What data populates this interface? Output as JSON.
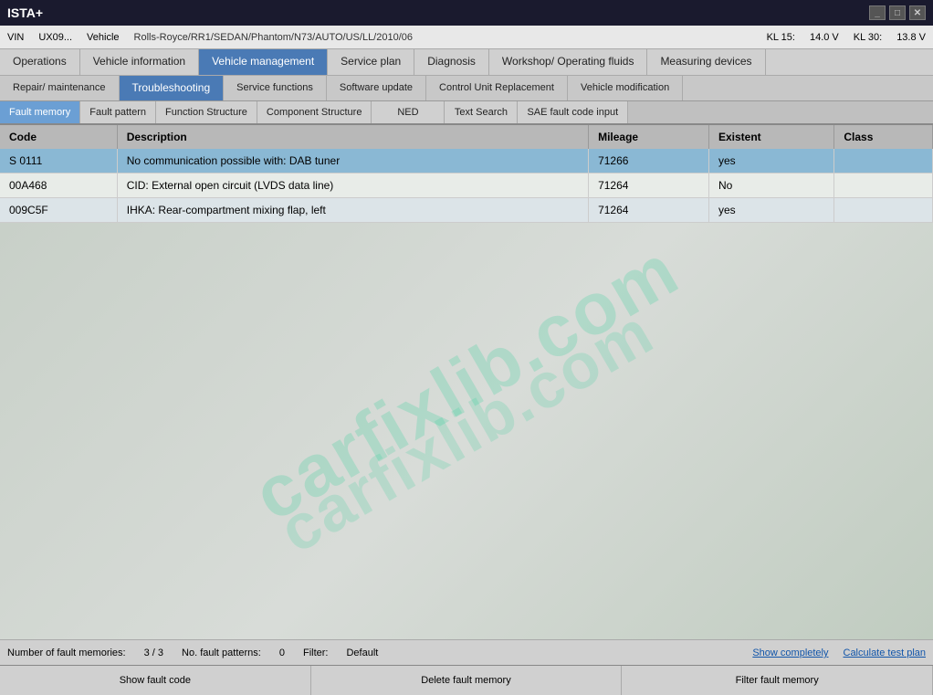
{
  "titlebar": {
    "app_name": "ISTA+",
    "controls": [
      "minimize",
      "maximize",
      "close"
    ]
  },
  "infobar": {
    "vin_label": "VIN",
    "vin_value": "UX09...",
    "vehicle_label": "Vehicle",
    "vehicle_value": "Rolls-Royce/RR1/SEDAN/Phantom/N73/AUTO/US/LL/2010/06",
    "kl15_label": "KL 15:",
    "kl15_value": "14.0 V",
    "kl30_label": "KL 30:",
    "kl30_value": "13.8 V"
  },
  "nav_row1": {
    "tabs": [
      {
        "id": "operations",
        "label": "Operations",
        "active": false
      },
      {
        "id": "vehicle-info",
        "label": "Vehicle information",
        "active": false
      },
      {
        "id": "vehicle-mgmt",
        "label": "Vehicle management",
        "active": true
      },
      {
        "id": "service-plan",
        "label": "Service plan",
        "active": false
      },
      {
        "id": "diagnosis",
        "label": "Diagnosis",
        "active": false
      },
      {
        "id": "workshop",
        "label": "Workshop/ Operating fluids",
        "active": false
      },
      {
        "id": "measuring",
        "label": "Measuring devices",
        "active": false
      }
    ]
  },
  "nav_row2": {
    "tabs": [
      {
        "id": "repair",
        "label": "Repair/ maintenance",
        "active": false
      },
      {
        "id": "troubleshooting",
        "label": "Troubleshooting",
        "active": true
      },
      {
        "id": "service-functions",
        "label": "Service functions",
        "active": false
      },
      {
        "id": "software-update",
        "label": "Software update",
        "active": false
      },
      {
        "id": "control-unit",
        "label": "Control Unit Replacement",
        "active": false
      },
      {
        "id": "vehicle-mod",
        "label": "Vehicle modification",
        "active": false
      }
    ]
  },
  "nav_row3": {
    "tabs": [
      {
        "id": "fault-memory",
        "label": "Fault memory",
        "active": true
      },
      {
        "id": "fault-pattern",
        "label": "Fault pattern",
        "active": false
      },
      {
        "id": "function-structure",
        "label": "Function Structure",
        "active": false
      },
      {
        "id": "component-structure",
        "label": "Component Structure",
        "active": false
      },
      {
        "id": "ned",
        "label": "NED",
        "active": false
      },
      {
        "id": "text-search",
        "label": "Text Search",
        "active": false
      },
      {
        "id": "sae-fault",
        "label": "SAE fault code input",
        "active": false
      }
    ]
  },
  "table": {
    "headers": [
      "Code",
      "Description",
      "Mileage",
      "Existent",
      "Class"
    ],
    "rows": [
      {
        "code": "S 0111",
        "description": "No communication possible with: DAB tuner",
        "mileage": "71266",
        "existent": "yes",
        "class": "",
        "selected": true
      },
      {
        "code": "00A468",
        "description": "CID: External open circuit (LVDS data line)",
        "mileage": "71264",
        "existent": "No",
        "class": "",
        "selected": false
      },
      {
        "code": "009C5F",
        "description": "IHKA: Rear-compartment mixing flap, left",
        "mileage": "71264",
        "existent": "yes",
        "class": "",
        "selected": false
      }
    ]
  },
  "statusbar": {
    "fault_memories_label": "Number of fault memories:",
    "fault_memories_value": "3 / 3",
    "fault_patterns_label": "No. fault patterns:",
    "fault_patterns_value": "0",
    "filter_label": "Filter:",
    "filter_value": "Default",
    "show_completely": "Show completely",
    "calculate_test": "Calculate test plan"
  },
  "actionbar": {
    "buttons": [
      "Show fault code",
      "Delete fault memory",
      "Filter fault memory"
    ]
  },
  "watermark": "carfixlib.com"
}
